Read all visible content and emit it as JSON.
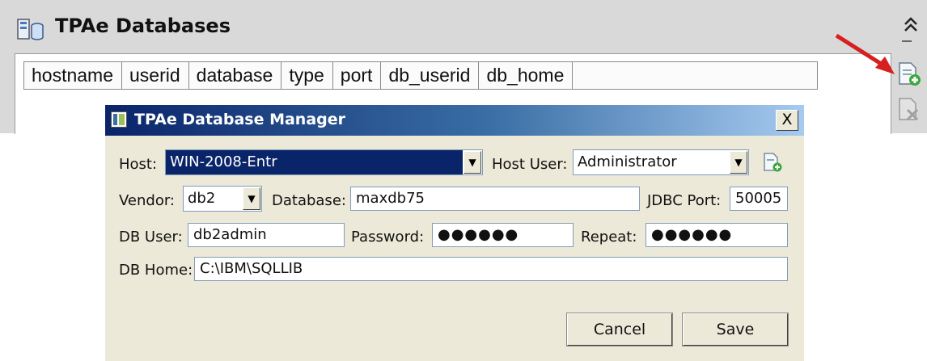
{
  "panel": {
    "title": "TPAe Databases",
    "collapse_icon": "double-chevron-up-icon",
    "columns": [
      "hostname",
      "userid",
      "database",
      "type",
      "port",
      "db_userid",
      "db_home"
    ],
    "side_actions": [
      {
        "name": "add-database-icon",
        "color": "#3aa83a"
      },
      {
        "name": "delete-database-icon",
        "color": "#a0a0a0"
      }
    ],
    "arrow_color": "#d62020"
  },
  "dialog": {
    "title": "TPAe Database Manager",
    "close_label": "X",
    "host_label": "Host:",
    "host_value": "WIN-2008-Entr",
    "host_user_label": "Host User:",
    "host_user_value": "Administrator",
    "vendor_label": "Vendor:",
    "vendor_value": "db2",
    "database_label": "Database:",
    "database_value": "maxdb75",
    "jdbc_port_label": "JDBC Port:",
    "jdbc_port_value": "50005",
    "db_user_label": "DB User:",
    "db_user_value": "db2admin",
    "password_label": "Password:",
    "password_value": "●●●●●●",
    "repeat_label": "Repeat:",
    "repeat_value": "●●●●●●",
    "db_home_label": "DB Home:",
    "db_home_value": "C:\\IBM\\SQLLIB",
    "cancel_label": "Cancel",
    "save_label": "Save",
    "dropdown_glyph": "▼"
  }
}
